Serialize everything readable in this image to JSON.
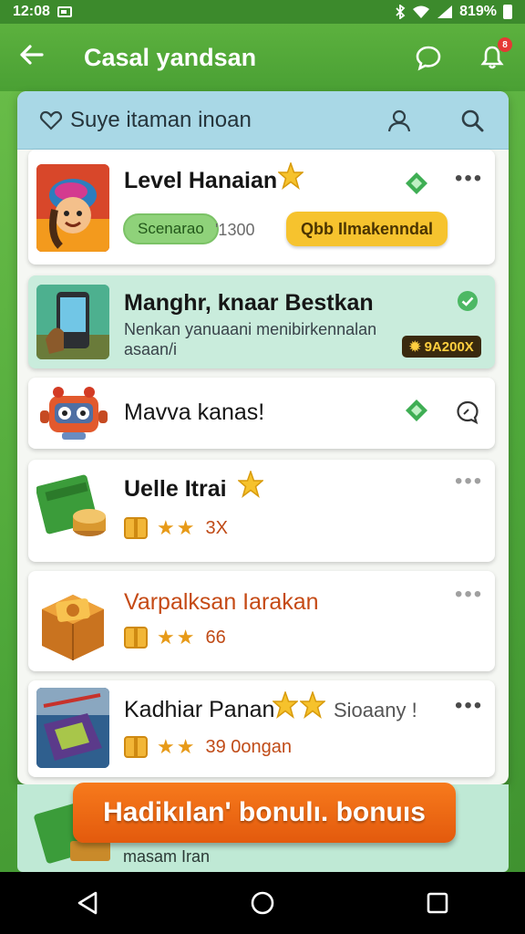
{
  "status_bar": {
    "time": "12:08",
    "battery": "819%"
  },
  "app_bar": {
    "title": "Casal yandsan",
    "notification_count": "8"
  },
  "search": {
    "label": "Suye itaman inoan"
  },
  "cards": [
    {
      "title": "Level Hanaian",
      "pill_green": "Scenarao",
      "count": "'1300",
      "pill_yellow": "Qbb Ilmakenndal"
    },
    {
      "title": "Manghr, knaar Bestkan",
      "subtitle": "Nenkan yanuaani menibirkennalan asaan/i",
      "badge": "9A200X"
    },
    {
      "title": "Mavva kanas!"
    },
    {
      "title": "Uelle Itrai",
      "stat": "3X"
    },
    {
      "title": "Varpalksan Iarakan",
      "stat": "66"
    },
    {
      "title": "Kadhiar Panan",
      "extra": "Sioaany !",
      "stat": "39 0ongan"
    }
  ],
  "cta": {
    "label": "Hadikılan' bonulı. bonuıs",
    "sub_label": "masam Iran"
  },
  "colors": {
    "accent_green": "#4fa83a",
    "cta_orange": "#e35a0d",
    "highlight": "#c9ecdc"
  }
}
